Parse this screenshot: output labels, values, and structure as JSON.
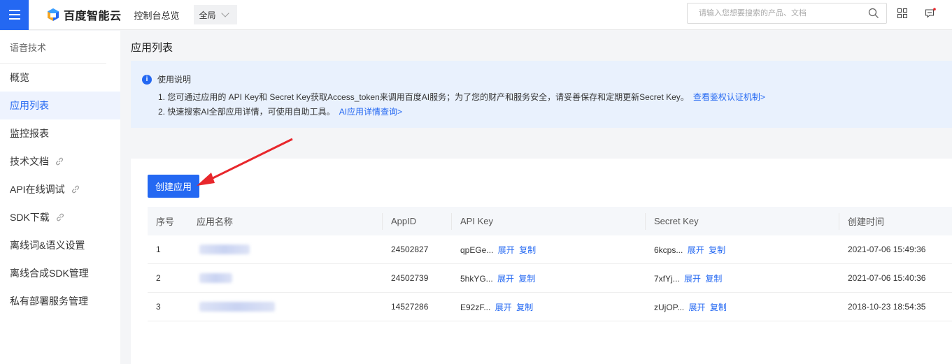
{
  "topbar": {
    "brand": "百度智能云",
    "overview": "控制台总览",
    "region": "全局",
    "search_placeholder": "请输入您想要搜索的产品、文档"
  },
  "sidebar": {
    "title": "语音技术",
    "items": [
      {
        "label": "概览",
        "link": false,
        "active": false
      },
      {
        "label": "应用列表",
        "link": false,
        "active": true
      },
      {
        "label": "监控报表",
        "link": false,
        "active": false
      },
      {
        "label": "技术文档",
        "link": true,
        "active": false
      },
      {
        "label": "API在线调试",
        "link": true,
        "active": false
      },
      {
        "label": "SDK下载",
        "link": true,
        "active": false
      },
      {
        "label": "离线词&语义设置",
        "link": false,
        "active": false
      },
      {
        "label": "离线合成SDK管理",
        "link": false,
        "active": false
      },
      {
        "label": "私有部署服务管理",
        "link": false,
        "active": false
      }
    ]
  },
  "main": {
    "title": "应用列表",
    "notice": {
      "heading": "使用说明",
      "line1": "1. 您可通过应用的 API Key和 Secret Key获取Access_token来调用百度AI服务；为了您的财产和服务安全，请妥善保存和定期更新Secret Key。",
      "line1_link": "查看鉴权认证机制>",
      "line2": "2. 快速搜索AI全部应用详情，可使用自助工具。",
      "line2_link": "AI应用详情查询>"
    },
    "create_button": "创建应用",
    "table": {
      "headers": [
        "序号",
        "应用名称",
        "AppID",
        "API Key",
        "Secret Key",
        "创建时间"
      ],
      "expand_label": "展开",
      "copy_label": "复制",
      "rows": [
        {
          "index": "1",
          "appid": "24502827",
          "api_key": "qpEGe...",
          "secret_key": "6kcps...",
          "created": "2021-07-06 15:49:36",
          "name_blur": 0.26
        },
        {
          "index": "2",
          "appid": "24502739",
          "api_key": "5hkYG...",
          "secret_key": "7xfYj...",
          "created": "2021-07-06 15:40:36",
          "name_blur": 0.17
        },
        {
          "index": "3",
          "appid": "14527286",
          "api_key": "E92zF...",
          "secret_key": "zUjOP...",
          "created": "2018-10-23 18:54:35",
          "name_blur": 0.39
        }
      ]
    }
  },
  "colors": {
    "accent": "#2468f2",
    "arrow": "#e8272c",
    "notice_bg": "#e9f1fd"
  }
}
